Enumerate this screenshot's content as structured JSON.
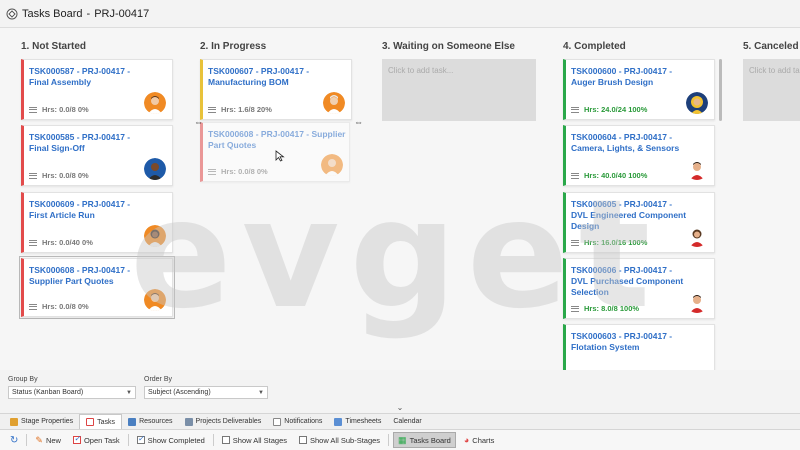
{
  "window": {
    "title": "Tasks Board",
    "separator": "-",
    "project": "PRJ-00417"
  },
  "columns": [
    {
      "title": "1. Not Started",
      "cards": [
        {
          "title": "TSK000587 - PRJ-00417 - Final Assembly",
          "hrs": "Hrs: 0.0/8 0%",
          "color": "#e24b4b",
          "avatar": "avatar-orange-man"
        },
        {
          "title": "TSK000585 - PRJ-00417 - Final Sign-Off",
          "hrs": "Hrs: 0.0/8 0%",
          "color": "#e24b4b",
          "avatar": "avatar-blue-man"
        },
        {
          "title": "TSK000609 - PRJ-00417 - First Article Run",
          "hrs": "Hrs: 0.0/40 0%",
          "color": "#e24b4b",
          "avatar": "avatar-orange-woman"
        },
        {
          "title": "TSK000608 - PRJ-00417 - Supplier Part Quotes",
          "hrs": "Hrs: 0.0/8 0%",
          "color": "#e24b4b",
          "avatar": "avatar-orange-man"
        }
      ]
    },
    {
      "title": "2. In Progress",
      "cards": [
        {
          "title": "TSK000607 - PRJ-00417 - Manufacturing BOM",
          "hrs": "Hrs: 1.6/8 20%",
          "color": "#e8c23a",
          "avatar": "avatar-orange-old-man"
        },
        {
          "title": "TSK000608 - PRJ-00417 - Supplier Part Quotes",
          "hrs": "Hrs: 0.0/8 0%",
          "color": "#e24b4b",
          "avatar": "avatar-orange-man"
        }
      ]
    },
    {
      "title": "3. Waiting on Someone Else",
      "add_task": "Click to add task...",
      "cards": []
    },
    {
      "title": "4. Completed",
      "cards": [
        {
          "title": "TSK000600 - PRJ-00417 - Auger Brush Design",
          "hrs": "Hrs: 24.0/24 100%",
          "color": "#2aa84a",
          "avatar": "avatar-yellow-woman"
        },
        {
          "title": "TSK000604 - PRJ-00417 - Camera, Lights, & Sensors",
          "hrs": "Hrs: 40.0/40 100%",
          "color": "#2aa84a",
          "avatar": "avatar-red-man"
        },
        {
          "title": "TSK000605 - PRJ-00417 - DVL Engineered Component Design",
          "hrs": "Hrs: 16.0/16 100%",
          "color": "#2aa84a",
          "avatar": "avatar-red-woman"
        },
        {
          "title": "TSK000606 - PRJ-00417 - DVL Purchased Component Selection",
          "hrs": "Hrs: 8.0/8 100%",
          "color": "#2aa84a",
          "avatar": "avatar-red-man"
        },
        {
          "title": "TSK000603 - PRJ-00417 - Flotation System",
          "hrs": "",
          "color": "#2aa84a",
          "avatar": ""
        }
      ]
    },
    {
      "title": "5. Canceled",
      "add_task": "Click to add task...",
      "cards": []
    }
  ],
  "watermark": "evget",
  "filters": {
    "group_by_label": "Group By",
    "group_by_value": "Status (Kanban Board)",
    "order_by_label": "Order By",
    "order_by_value": "Subject (Ascending)"
  },
  "tabs": [
    "Stage Properties",
    "Tasks",
    "Resources",
    "Projects Deliverables",
    "Notifications",
    "Timesheets",
    "Calendar"
  ],
  "active_tab": "Tasks",
  "toolbar": {
    "new": "New",
    "open_task": "Open Task",
    "show_completed": "Show Completed",
    "show_all_stages": "Show All Stages",
    "show_all_substages": "Show All Sub-Stages",
    "tasks_board": "Tasks Board",
    "charts": "Charts"
  },
  "colors": {
    "accent": "#2f6fc7",
    "not_started": "#e24b4b",
    "in_progress": "#e8c23a",
    "completed": "#2aa84a"
  }
}
